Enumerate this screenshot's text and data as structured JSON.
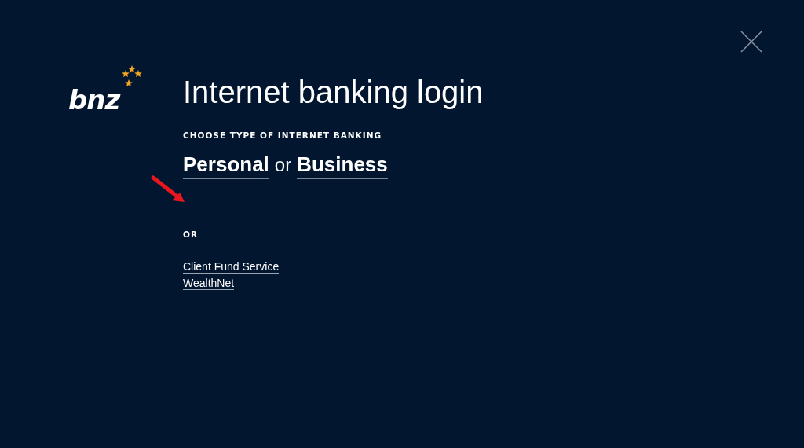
{
  "logo": {
    "text": "bnz"
  },
  "title": "Internet banking login",
  "choose": {
    "heading": "CHOOSE TYPE OF INTERNET BANKING",
    "options": [
      {
        "label": "Personal"
      },
      {
        "label": "Business"
      }
    ],
    "separator": "or"
  },
  "or_heading": "OR",
  "links": [
    {
      "label": "Client Fund Service"
    },
    {
      "label": "WealthNet"
    }
  ]
}
